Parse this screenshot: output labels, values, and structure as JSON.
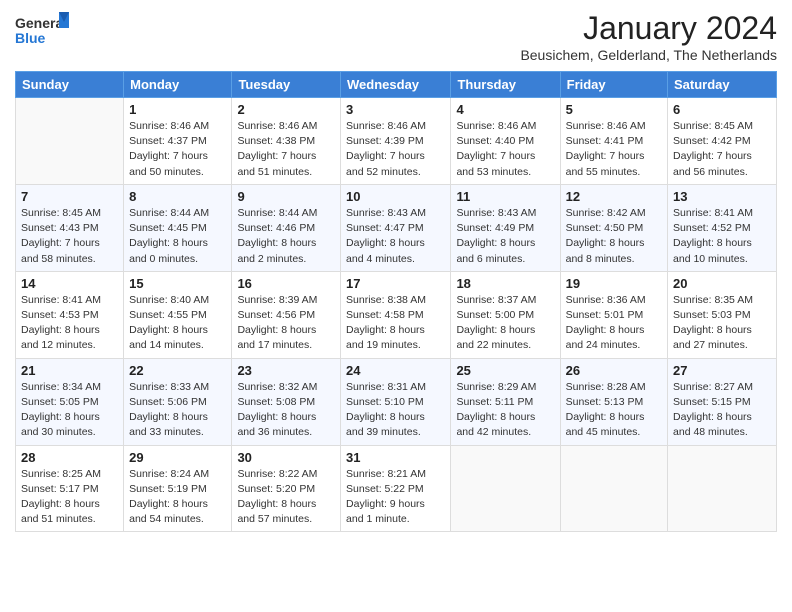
{
  "header": {
    "logo_general": "General",
    "logo_blue": "Blue",
    "month": "January 2024",
    "location": "Beusichem, Gelderland, The Netherlands"
  },
  "weekdays": [
    "Sunday",
    "Monday",
    "Tuesday",
    "Wednesday",
    "Thursday",
    "Friday",
    "Saturday"
  ],
  "weeks": [
    [
      {
        "day": "",
        "info": ""
      },
      {
        "day": "1",
        "info": "Sunrise: 8:46 AM\nSunset: 4:37 PM\nDaylight: 7 hours\nand 50 minutes."
      },
      {
        "day": "2",
        "info": "Sunrise: 8:46 AM\nSunset: 4:38 PM\nDaylight: 7 hours\nand 51 minutes."
      },
      {
        "day": "3",
        "info": "Sunrise: 8:46 AM\nSunset: 4:39 PM\nDaylight: 7 hours\nand 52 minutes."
      },
      {
        "day": "4",
        "info": "Sunrise: 8:46 AM\nSunset: 4:40 PM\nDaylight: 7 hours\nand 53 minutes."
      },
      {
        "day": "5",
        "info": "Sunrise: 8:46 AM\nSunset: 4:41 PM\nDaylight: 7 hours\nand 55 minutes."
      },
      {
        "day": "6",
        "info": "Sunrise: 8:45 AM\nSunset: 4:42 PM\nDaylight: 7 hours\nand 56 minutes."
      }
    ],
    [
      {
        "day": "7",
        "info": "Sunrise: 8:45 AM\nSunset: 4:43 PM\nDaylight: 7 hours\nand 58 minutes."
      },
      {
        "day": "8",
        "info": "Sunrise: 8:44 AM\nSunset: 4:45 PM\nDaylight: 8 hours\nand 0 minutes."
      },
      {
        "day": "9",
        "info": "Sunrise: 8:44 AM\nSunset: 4:46 PM\nDaylight: 8 hours\nand 2 minutes."
      },
      {
        "day": "10",
        "info": "Sunrise: 8:43 AM\nSunset: 4:47 PM\nDaylight: 8 hours\nand 4 minutes."
      },
      {
        "day": "11",
        "info": "Sunrise: 8:43 AM\nSunset: 4:49 PM\nDaylight: 8 hours\nand 6 minutes."
      },
      {
        "day": "12",
        "info": "Sunrise: 8:42 AM\nSunset: 4:50 PM\nDaylight: 8 hours\nand 8 minutes."
      },
      {
        "day": "13",
        "info": "Sunrise: 8:41 AM\nSunset: 4:52 PM\nDaylight: 8 hours\nand 10 minutes."
      }
    ],
    [
      {
        "day": "14",
        "info": "Sunrise: 8:41 AM\nSunset: 4:53 PM\nDaylight: 8 hours\nand 12 minutes."
      },
      {
        "day": "15",
        "info": "Sunrise: 8:40 AM\nSunset: 4:55 PM\nDaylight: 8 hours\nand 14 minutes."
      },
      {
        "day": "16",
        "info": "Sunrise: 8:39 AM\nSunset: 4:56 PM\nDaylight: 8 hours\nand 17 minutes."
      },
      {
        "day": "17",
        "info": "Sunrise: 8:38 AM\nSunset: 4:58 PM\nDaylight: 8 hours\nand 19 minutes."
      },
      {
        "day": "18",
        "info": "Sunrise: 8:37 AM\nSunset: 5:00 PM\nDaylight: 8 hours\nand 22 minutes."
      },
      {
        "day": "19",
        "info": "Sunrise: 8:36 AM\nSunset: 5:01 PM\nDaylight: 8 hours\nand 24 minutes."
      },
      {
        "day": "20",
        "info": "Sunrise: 8:35 AM\nSunset: 5:03 PM\nDaylight: 8 hours\nand 27 minutes."
      }
    ],
    [
      {
        "day": "21",
        "info": "Sunrise: 8:34 AM\nSunset: 5:05 PM\nDaylight: 8 hours\nand 30 minutes."
      },
      {
        "day": "22",
        "info": "Sunrise: 8:33 AM\nSunset: 5:06 PM\nDaylight: 8 hours\nand 33 minutes."
      },
      {
        "day": "23",
        "info": "Sunrise: 8:32 AM\nSunset: 5:08 PM\nDaylight: 8 hours\nand 36 minutes."
      },
      {
        "day": "24",
        "info": "Sunrise: 8:31 AM\nSunset: 5:10 PM\nDaylight: 8 hours\nand 39 minutes."
      },
      {
        "day": "25",
        "info": "Sunrise: 8:29 AM\nSunset: 5:11 PM\nDaylight: 8 hours\nand 42 minutes."
      },
      {
        "day": "26",
        "info": "Sunrise: 8:28 AM\nSunset: 5:13 PM\nDaylight: 8 hours\nand 45 minutes."
      },
      {
        "day": "27",
        "info": "Sunrise: 8:27 AM\nSunset: 5:15 PM\nDaylight: 8 hours\nand 48 minutes."
      }
    ],
    [
      {
        "day": "28",
        "info": "Sunrise: 8:25 AM\nSunset: 5:17 PM\nDaylight: 8 hours\nand 51 minutes."
      },
      {
        "day": "29",
        "info": "Sunrise: 8:24 AM\nSunset: 5:19 PM\nDaylight: 8 hours\nand 54 minutes."
      },
      {
        "day": "30",
        "info": "Sunrise: 8:22 AM\nSunset: 5:20 PM\nDaylight: 8 hours\nand 57 minutes."
      },
      {
        "day": "31",
        "info": "Sunrise: 8:21 AM\nSunset: 5:22 PM\nDaylight: 9 hours\nand 1 minute."
      },
      {
        "day": "",
        "info": ""
      },
      {
        "day": "",
        "info": ""
      },
      {
        "day": "",
        "info": ""
      }
    ]
  ]
}
